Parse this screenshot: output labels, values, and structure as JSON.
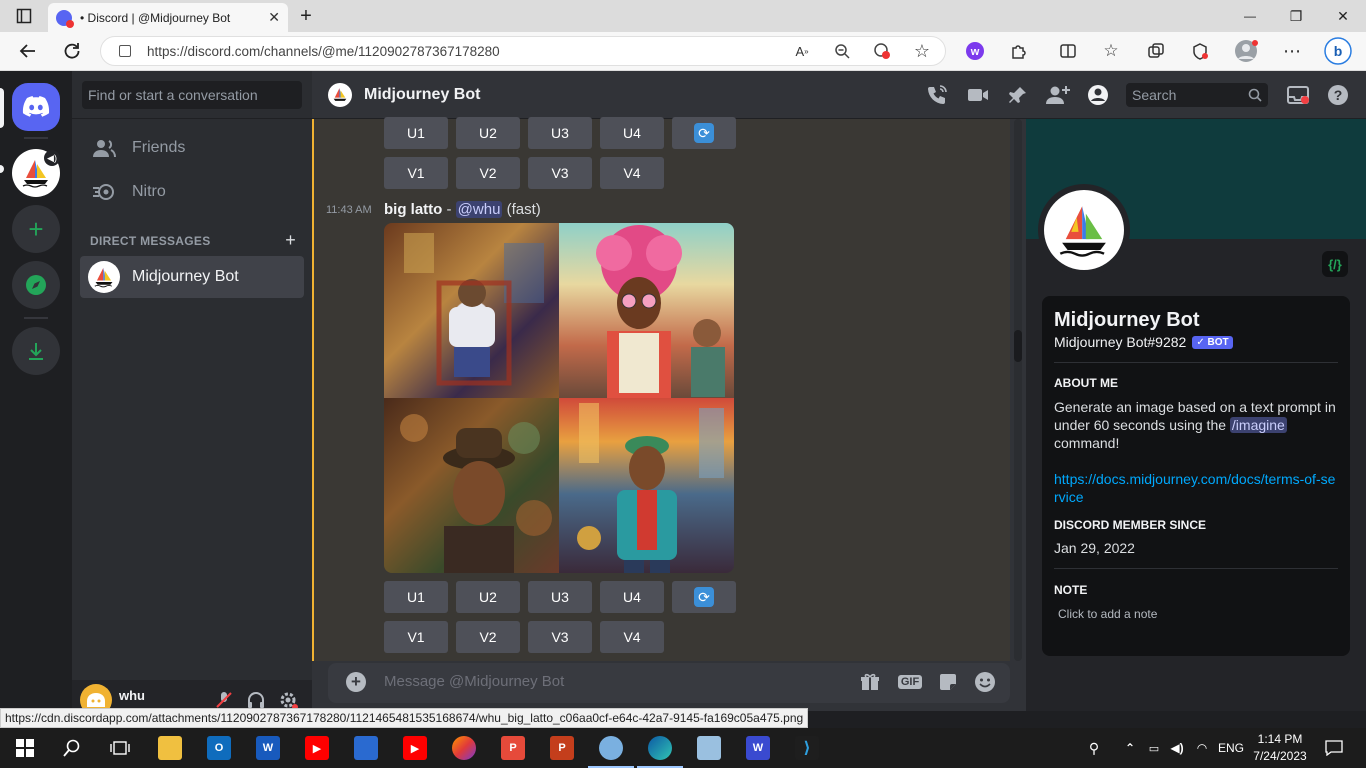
{
  "browser": {
    "tab_title": "• Discord | @Midjourney Bot",
    "tab_close": "✕",
    "new_tab": "+",
    "url": "https://discord.com/channels/@me/1120902787367178280",
    "window_minimize": "—",
    "window_restore": "❐",
    "window_close": "✕"
  },
  "sidebar": {
    "search_placeholder": "Find or start a conversation",
    "items": [
      {
        "label": "Friends"
      },
      {
        "label": "Nitro"
      }
    ],
    "dm_header": "DIRECT MESSAGES",
    "dm_add": "+",
    "dm_active": "Midjourney Bot",
    "user_name": "whu"
  },
  "header": {
    "title": "Midjourney Bot",
    "search_placeholder": "Search"
  },
  "chat": {
    "upscale_buttons": [
      "U1",
      "U2",
      "U3",
      "U4"
    ],
    "variation_buttons": [
      "V1",
      "V2",
      "V3",
      "V4"
    ],
    "message": {
      "time": "11:43 AM",
      "prompt": "big latto",
      "separator": " - ",
      "mention": "@whu",
      "mode": " (fast)"
    },
    "composer_placeholder": "Message @Midjourney Bot",
    "gif_label": "GIF"
  },
  "profile": {
    "name": "Midjourney Bot",
    "tag": "Midjourney Bot#9282",
    "bot_badge": "✓ BOT",
    "about_header": "ABOUT ME",
    "about_text_1": "Generate an image based on a text prompt in under 60 seconds using the ",
    "about_cmd": "/imagine",
    "about_text_2": " command!",
    "link": "https://docs.midjourney.com/docs/terms-of-service",
    "member_since_header": "DISCORD MEMBER SINCE",
    "member_since": "Jan 29, 2022",
    "note_header": "NOTE",
    "note_placeholder": "Click to add a note",
    "badge": "{/}"
  },
  "status_url": "https://cdn.discordapp.com/attachments/1120902787367178280/1121465481535168674/whu_big_latto_c06aa0cf-e64c-42a7-9145-fa169c05a475.png",
  "taskbar": {
    "time": "1:14 PM",
    "date": "7/24/2023",
    "lang": "ENG"
  },
  "colors": {
    "blurple": "#5865f2",
    "green": "#23a559",
    "highlight_border": "#f0b232"
  }
}
